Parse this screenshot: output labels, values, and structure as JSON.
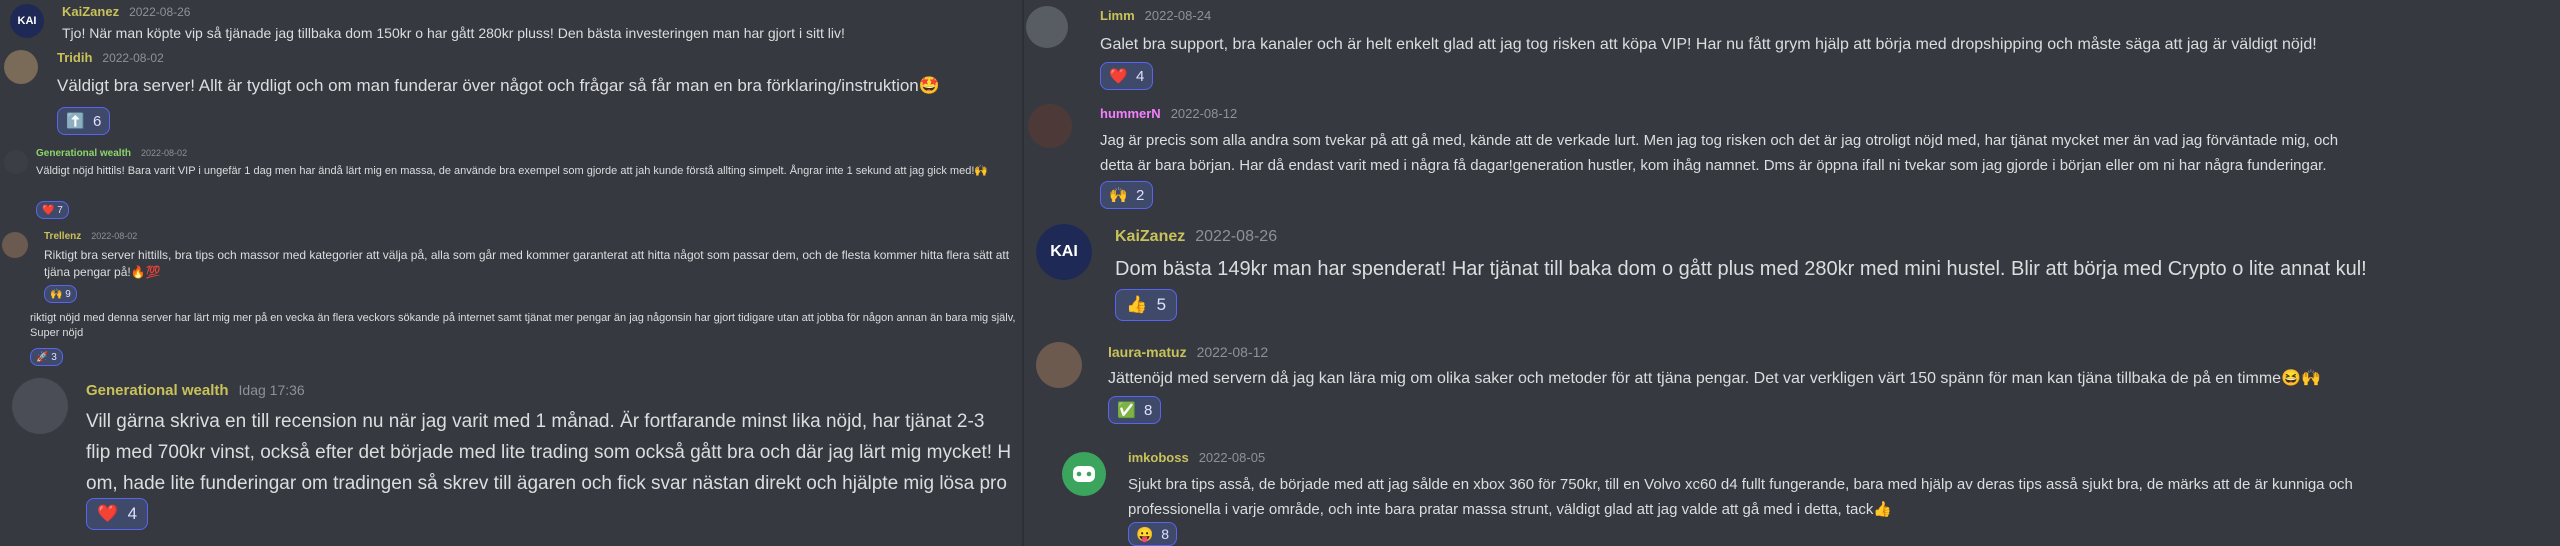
{
  "colors": {
    "background": "#363940",
    "text": "#dcddde",
    "muted": "#8e9297",
    "reaction_bg": "#3f4a6b",
    "reaction_border": "#5865f2",
    "name_yellow": "#c9c25a",
    "name_pink": "#f47fff",
    "name_green": "#8bd56a"
  },
  "left": [
    {
      "author": "KaiZanez",
      "date": "2022-08-26",
      "text": "Tjo! När man köpte vip så tjänade jag tillbaka dom 150kr o har gått 280kr pluss! Den bästa investeringen man har gjort i sitt liv!",
      "avatar_text": "KAI"
    },
    {
      "author": "Tridih",
      "date": "2022-08-02",
      "text": "Väldigt bra server! Allt är tydligt och om man funderar över något och frågar så får man en bra förklaring/instruktion",
      "emoji": "🤩",
      "reaction": {
        "icon": "⬆️",
        "count": "6"
      }
    },
    {
      "author": "Generational wealth",
      "date": "2022-08-02",
      "text": "Väldigt nöjd hittils! Bara varit VIP i ungefär 1 dag men har ändå lärt mig en massa, de använde bra exempel som gjorde att jah kunde förstå allting simpelt. Ångrar inte 1 sekund att jag gick med!",
      "emoji": "🙌",
      "reaction": {
        "icon": "❤️",
        "count": "7"
      }
    },
    {
      "author": "Trellenz",
      "date": "2022-08-02",
      "text": "Riktigt bra server hittills, bra tips och massor med kategorier att välja på, alla som går med kommer garanterat att hitta något som passar dem, och de flesta kommer hitta flera sätt att tjäna pengar på!",
      "emoji": "🔥💯",
      "reaction": {
        "icon": "🙌",
        "count": "9"
      }
    },
    {
      "author": "",
      "date": "",
      "text": "riktigt nöjd med denna server har lärt mig mer på en vecka än flera veckors sökande på internet samt tjänat mer pengar än jag någonsin har gjort tidigare utan att jobba för någon annan än bara mig själv, Super nöjd",
      "reaction": {
        "icon": "🚀",
        "count": "3"
      }
    },
    {
      "author": "Generational wealth",
      "date": "Idag 17:36",
      "lines": [
        "Vill gärna skriva en till recension nu när jag varit med 1 månad. Är fortfarande minst lika nöjd, har tjänat 2-3",
        "flip med 700kr vinst, också efter det började med lite trading som också gått bra och där jag lärt mig mycket! H",
        "om, hade lite funderingar om tradingen så skrev till ägaren och fick svar nästan direkt och hjälpte mig lösa pro"
      ],
      "reaction": {
        "icon": "❤️",
        "count": "4"
      }
    }
  ],
  "right": [
    {
      "author": "Limm",
      "date": "2022-08-24",
      "text": "Galet bra support, bra kanaler och är helt enkelt glad att jag tog risken att köpa VIP! Har nu fått grym hjälp att börja med dropshipping och måste säga att jag är väldigt nöjd!",
      "reaction": {
        "icon": "❤️",
        "count": "4"
      }
    },
    {
      "author": "hummerN",
      "date": "2022-08-12",
      "lines": [
        "Jag är precis som alla andra som tvekar på att gå med, kände att de verkade lurt. Men jag tog risken och det är jag otroligt nöjd med, har tjänat mycket mer än vad jag förväntade mig, och",
        "detta är bara början. Har då endast varit med i några få dagar!generation hustler, kom ihåg namnet. Dms är öppna ifall ni tvekar som jag gjorde i början eller om ni har några funderingar."
      ],
      "reaction": {
        "icon": "🙌",
        "count": "2"
      }
    },
    {
      "author": "KaiZanez",
      "date": "2022-08-26",
      "text": "Dom bästa 149kr man har spenderat! Har tjänat till baka dom o gått plus med 280kr med mini hustel. Blir att börja med Crypto o lite annat kul!",
      "avatar_text": "KAI",
      "reaction": {
        "icon": "👍",
        "count": "5"
      }
    },
    {
      "author": "laura-matuz",
      "date": "2022-08-12",
      "text": "Jättenöjd med servern då jag kan lära mig om  olika saker och metoder för att tjäna pengar. Det var verkligen värt 150 spänn för man kan tjäna tillbaka de på en timme",
      "emoji": "😆🙌",
      "reaction": {
        "icon": "✅",
        "count": "8"
      }
    },
    {
      "author": "imkoboss",
      "date": "2022-08-05",
      "lines": [
        "Sjukt bra tips asså, de började med att jag sålde en xbox 360 för 750kr, till en Volvo xc60 d4 fullt fungerande, bara med hjälp av deras tips asså sjukt bra, de märks att de är kunniga och",
        "professionella i varje område, och inte bara pratar massa strunt, väldigt glad att jag valde att gå med i detta, tack"
      ],
      "emoji": "👍",
      "reaction": {
        "icon": "😛",
        "count": "8"
      }
    }
  ]
}
